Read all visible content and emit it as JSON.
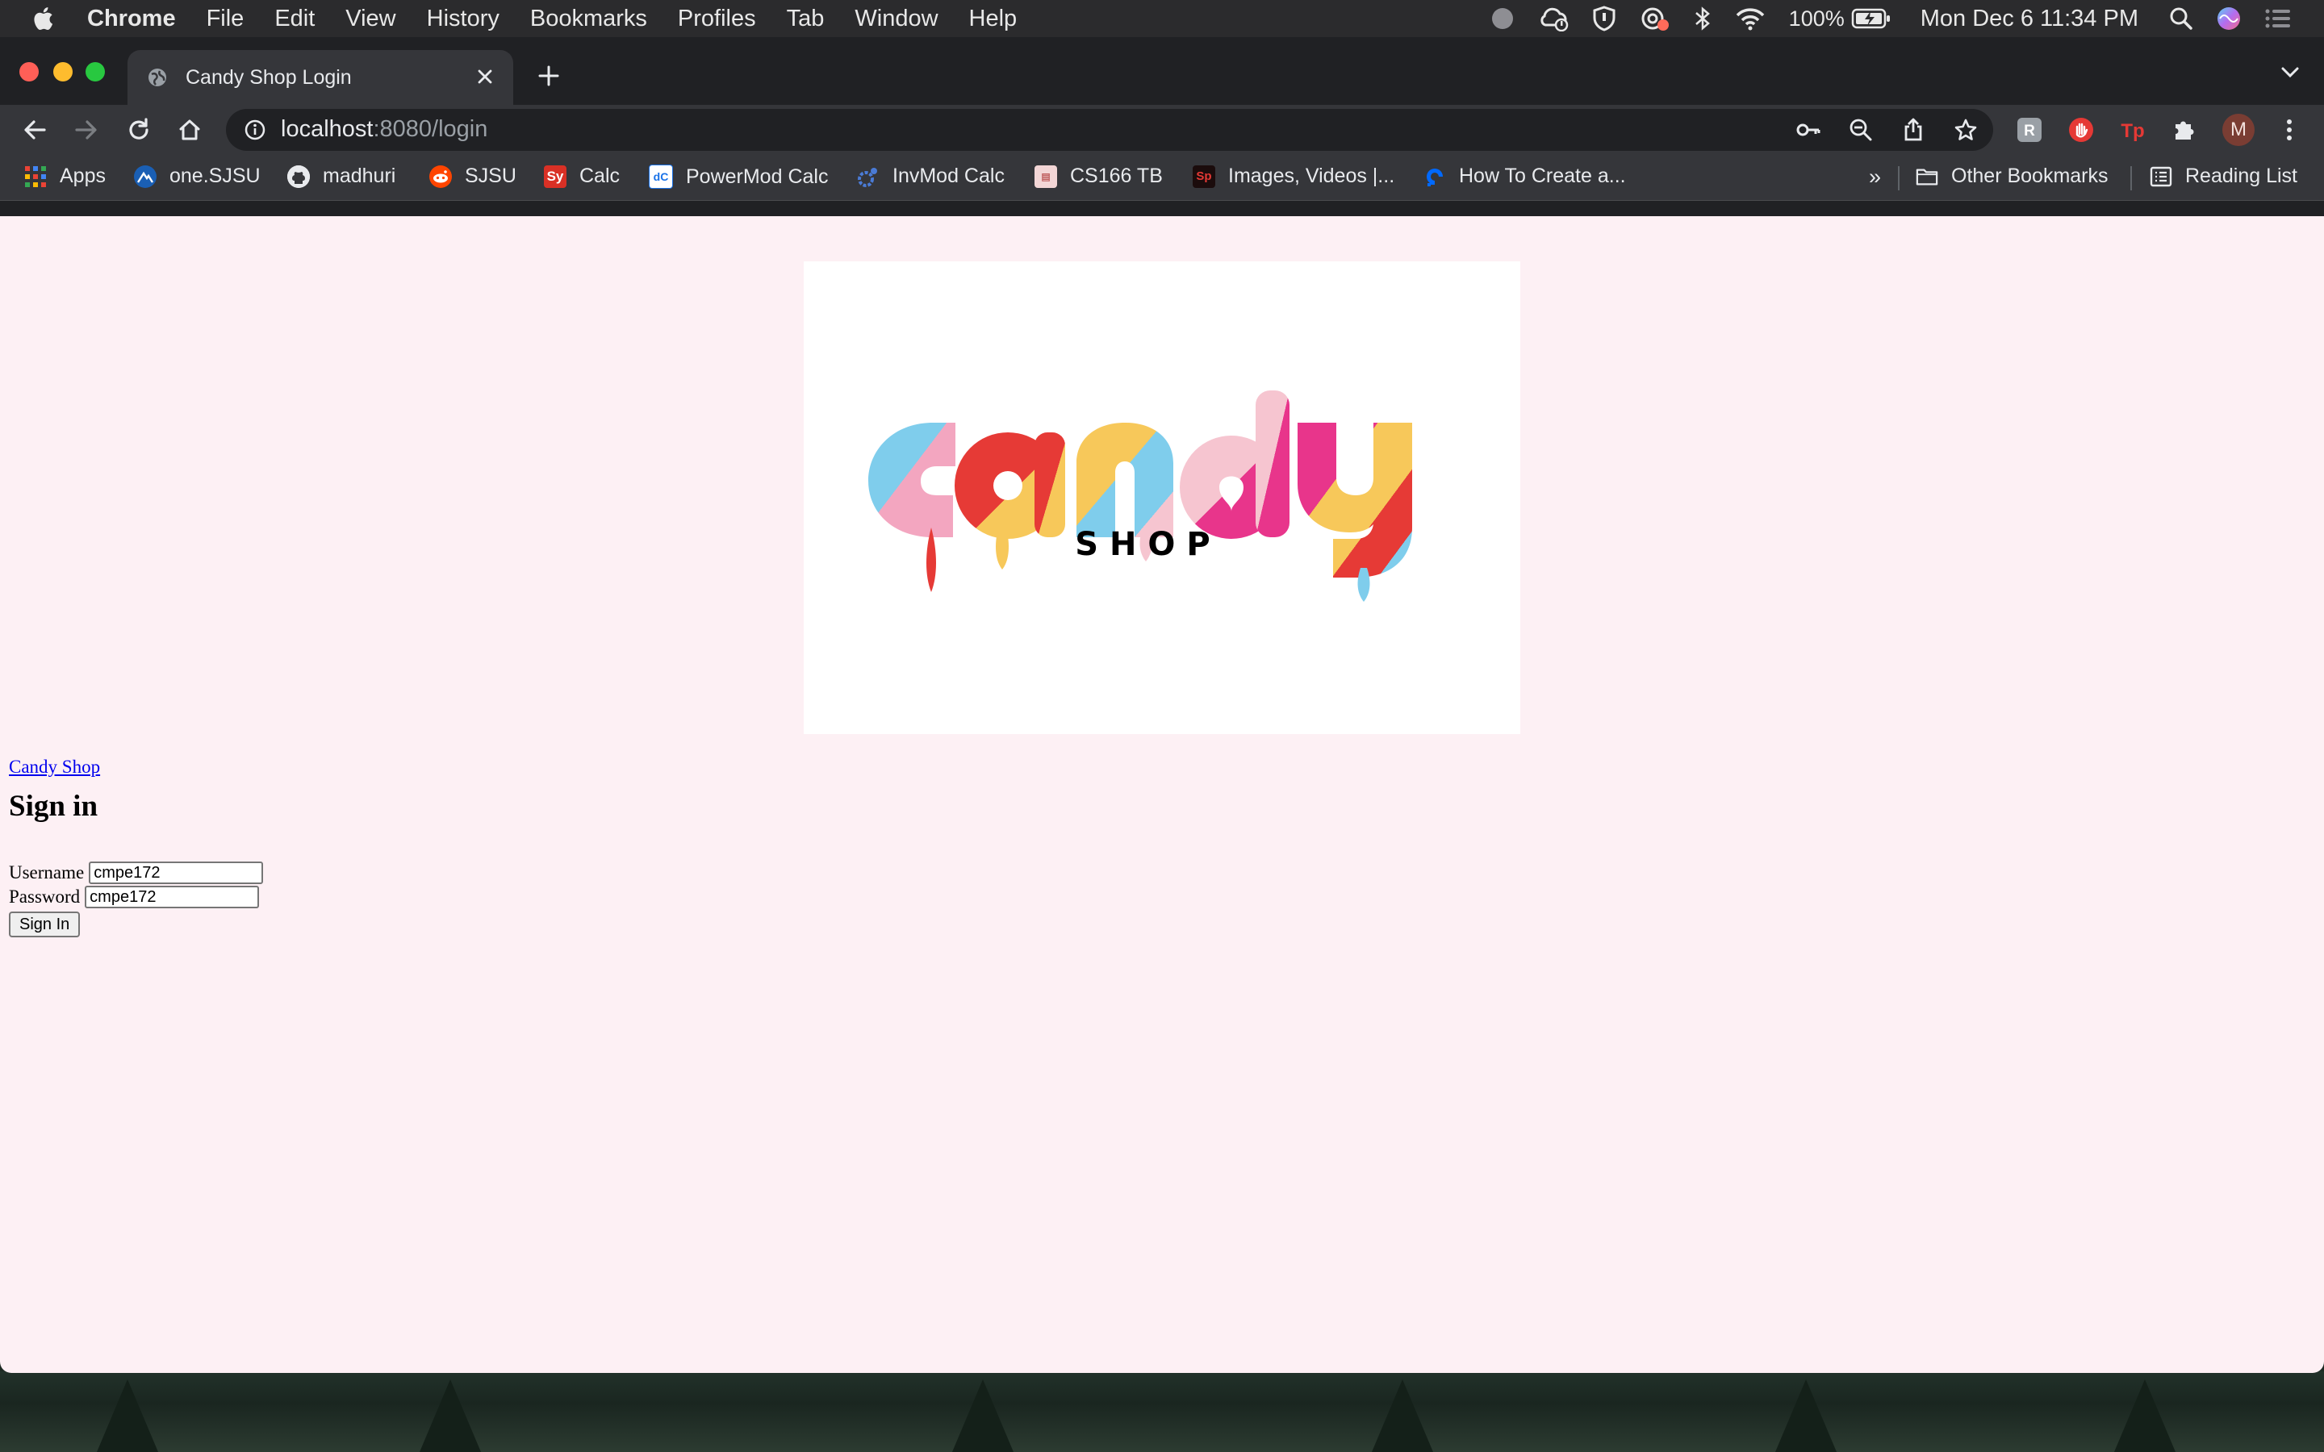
{
  "menubar": {
    "app_name": "Chrome",
    "items": [
      "File",
      "Edit",
      "View",
      "History",
      "Bookmarks",
      "Profiles",
      "Tab",
      "Window",
      "Help"
    ],
    "battery": "100%",
    "datetime": "Mon Dec 6  11:34 PM"
  },
  "tab": {
    "title": "Candy Shop Login"
  },
  "address_bar": {
    "host": "localhost",
    "rest": ":8080/login"
  },
  "bookmarks": {
    "items": [
      "Apps",
      "one.SJSU",
      "madhuri",
      "SJSU",
      "Calc",
      "PowerMod Calc",
      "InvMod Calc",
      "CS166 TB",
      "Images, Videos |...",
      "How To Create a..."
    ],
    "overflow": "»",
    "other": "Other Bookmarks",
    "reading_list": "Reading List"
  },
  "profile": {
    "initial": "M"
  },
  "page": {
    "logo": {
      "word": "candy",
      "subword": "S H O P"
    },
    "home_link": "Candy Shop",
    "heading": "Sign in",
    "username_label": "Username",
    "username_value": "cmpe172",
    "password_label": "Password",
    "password_value": "cmpe172",
    "submit_label": "Sign In"
  },
  "colors": {
    "page_bg": "#fdf0f4",
    "candy_blue": "#7fcdec",
    "candy_pink": "#f3a6c0",
    "candy_red": "#e63a36",
    "candy_yellow": "#f7c85a",
    "candy_magenta": "#e8358b",
    "candy_light_pink": "#f6c5d0"
  }
}
